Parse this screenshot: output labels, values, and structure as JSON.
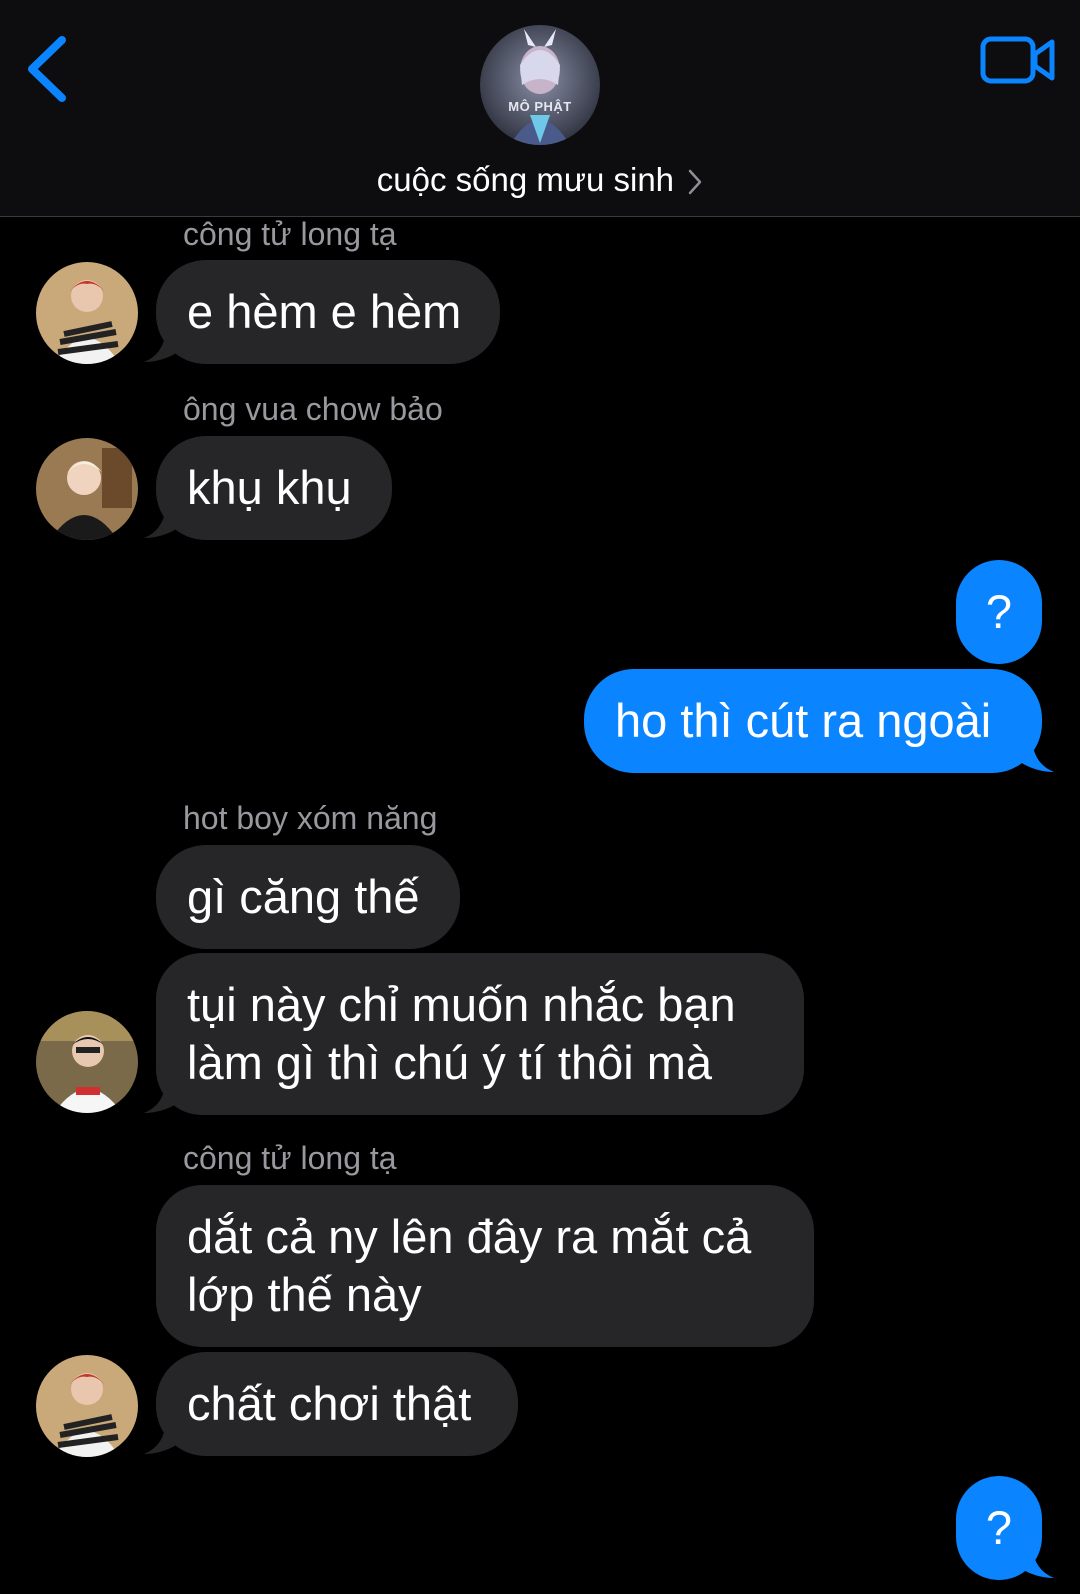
{
  "header": {
    "group_name": "cuộc sống mưu sinh",
    "avatar_text": "MÔ PHẬT",
    "back_icon": "chevron-left-icon",
    "video_icon": "video-camera-icon",
    "accent": "#0a84ff"
  },
  "messages": [
    {
      "sender": "công tử long tạ",
      "text": "e hèm e hèm"
    },
    {
      "sender": "ông vua chow bảo",
      "text": "khụ khụ"
    },
    {
      "outgoing": true,
      "text": "?"
    },
    {
      "outgoing": true,
      "text": "ho thì cút ra ngoài"
    },
    {
      "sender": "hot boy xóm năng",
      "text": "gì căng thế"
    },
    {
      "lines": [
        "tụi này chỉ muốn nhắc bạn",
        "làm gì thì chú ý tí thôi mà"
      ]
    },
    {
      "sender": "công tử long tạ",
      "lines": [
        "dắt cả ny lên đây ra mắt cả",
        "lớp thế này"
      ]
    },
    {
      "text": "chất chơi thật"
    },
    {
      "outgoing": true,
      "text": "?"
    }
  ],
  "colors": {
    "incoming_bubble": "#262628",
    "outgoing_bubble": "#0a84ff",
    "sender_name": "#98989e",
    "background": "#000000"
  }
}
